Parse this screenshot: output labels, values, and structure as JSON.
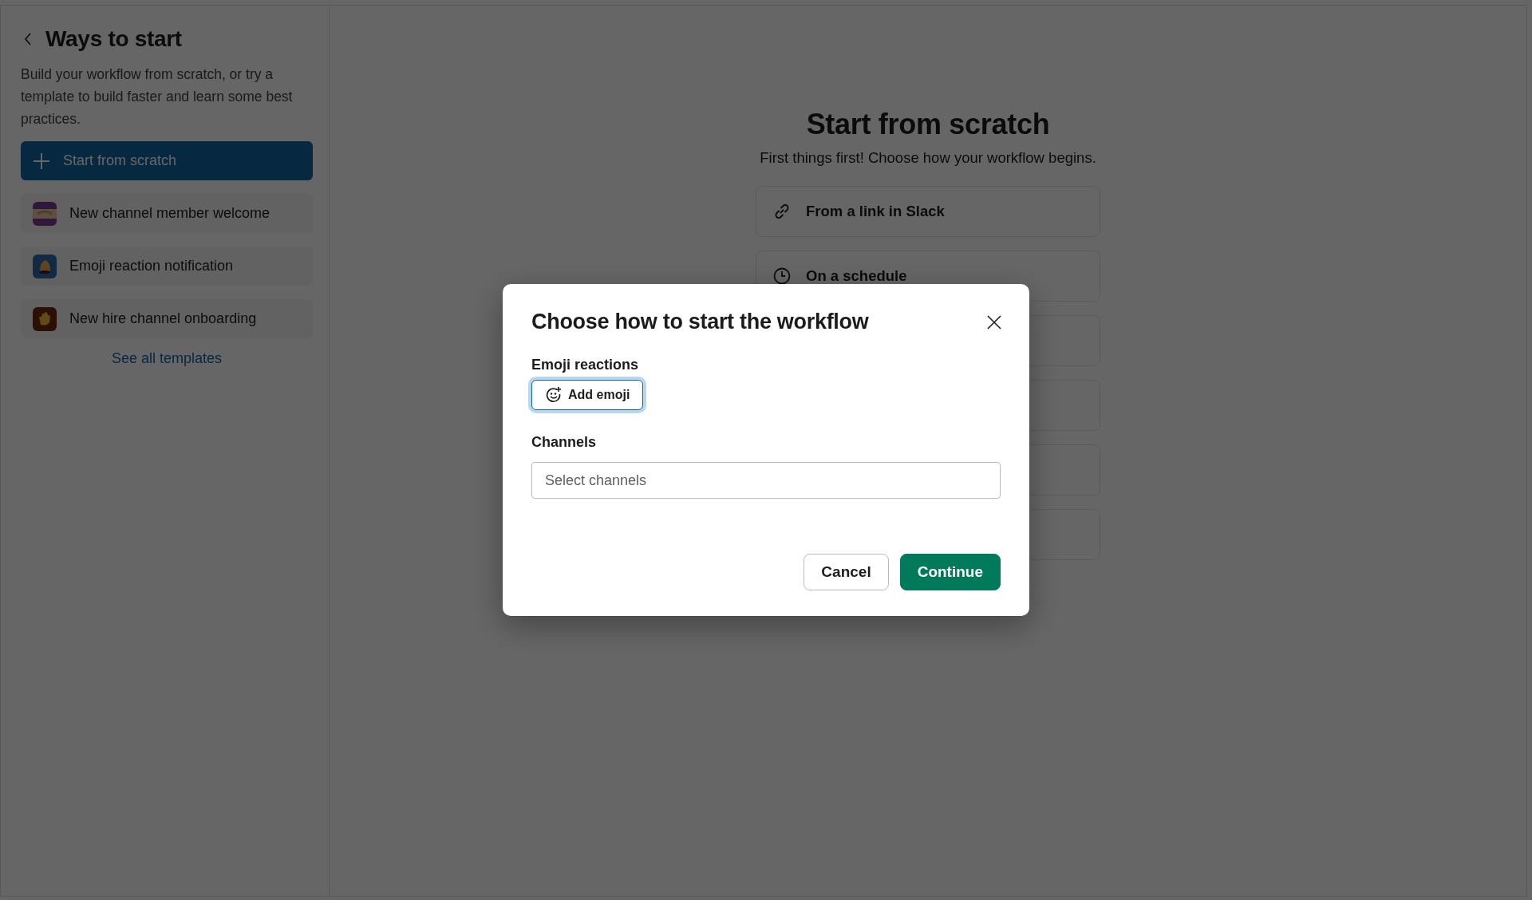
{
  "sidebar": {
    "title": "Ways to start",
    "description": "Build your workflow from scratch, or try a template to build faster and learn some best practices.",
    "items": [
      {
        "kind": "new",
        "label": "Start from scratch",
        "selected": true
      },
      {
        "kind": "template",
        "label": "New channel member welcome",
        "selected": false
      },
      {
        "kind": "template",
        "label": "Emoji reaction notification",
        "selected": false
      },
      {
        "kind": "template",
        "label": "New hire channel onboarding",
        "selected": false
      }
    ],
    "see_all_link": "See all templates"
  },
  "main": {
    "title": "Start from scratch",
    "subtitle": "First things first! Choose how your workflow begins.",
    "triggers": [
      {
        "kind": "link",
        "label": "From a link in Slack"
      },
      {
        "kind": "clock",
        "label": "On a schedule"
      }
    ]
  },
  "dialog": {
    "title": "Choose how to start the workflow",
    "emoji_label": "Emoji reactions",
    "add_emoji_button": {
      "label": "Add emoji",
      "focused": true
    },
    "channels_label": "Channels",
    "channels_field": {
      "placeholder": "Select channels"
    },
    "buttons": [
      {
        "kind": "secondary",
        "label": "Cancel"
      },
      {
        "kind": "primary",
        "label": "Continue"
      }
    ]
  }
}
